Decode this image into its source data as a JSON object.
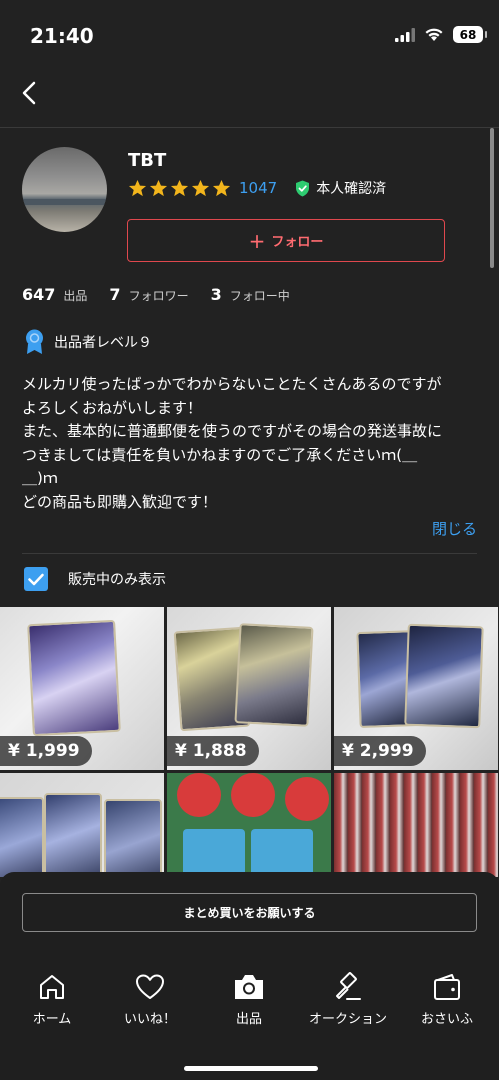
{
  "status_bar": {
    "time": "21:40",
    "battery": "68"
  },
  "profile": {
    "username": "TBT",
    "stars": 5,
    "rating_count": "1047",
    "verified_label": "本人確認済",
    "follow_label": "フォロー"
  },
  "stats": [
    {
      "value": "647",
      "label": "出品"
    },
    {
      "value": "7",
      "label": "フォロワー"
    },
    {
      "value": "3",
      "label": "フォロー中"
    }
  ],
  "level_label": "出品者レベル９",
  "bio_lines": [
    "メルカリ使ったばっかでわからないことたくさんあるのですが",
    "よろしくおねがいします！",
    "また、基本的に普通郵便を使うのですがその場合の発送事故に",
    "つきましては責任を負いかねますのでご了承くださいｍ(＿",
    "＿)ｍ",
    "どの商品も即購入歓迎です！"
  ],
  "close_label": "閉じる",
  "filter": {
    "label": "販売中のみ表示",
    "checked": true
  },
  "items": [
    {
      "price": "¥ 1,999"
    },
    {
      "price": "¥ 1,888"
    },
    {
      "price": "¥ 2,999"
    },
    {
      "price": ""
    },
    {
      "price": ""
    },
    {
      "price": ""
    }
  ],
  "bundle_button": "まとめ買いをお願いする",
  "tabs": [
    {
      "label": "ホーム",
      "icon": "home-icon"
    },
    {
      "label": "いいね！",
      "icon": "heart-icon"
    },
    {
      "label": "出品",
      "icon": "camera-icon"
    },
    {
      "label": "オークション",
      "icon": "gavel-icon"
    },
    {
      "label": "おさいふ",
      "icon": "wallet-icon"
    }
  ],
  "colors": {
    "accent": "#3d9ff0",
    "follow": "#e0484e",
    "star": "#f2b51c",
    "verified": "#2ecc71",
    "background": "#222222"
  }
}
